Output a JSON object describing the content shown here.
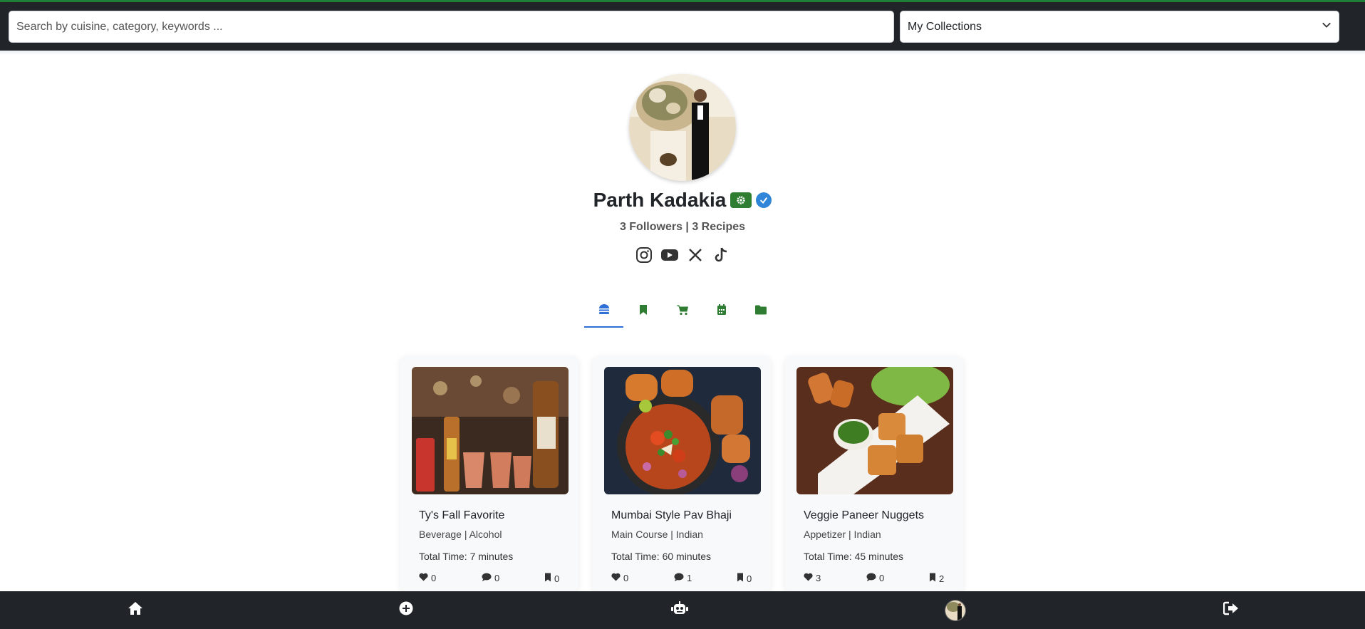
{
  "search": {
    "placeholder": "Search by cuisine, category, keywords ..."
  },
  "collections": {
    "selected": "My Collections"
  },
  "profile": {
    "name": "Parth Kadakia",
    "stats": "3 Followers | 3 Recipes",
    "socials": [
      "instagram-icon",
      "youtube-icon",
      "x-icon",
      "tiktok-icon"
    ]
  },
  "tabs": [
    {
      "icon": "burger-icon",
      "active": true
    },
    {
      "icon": "bookmark-icon",
      "active": false
    },
    {
      "icon": "cart-icon",
      "active": false
    },
    {
      "icon": "calendar-icon",
      "active": false
    },
    {
      "icon": "folder-icon",
      "active": false
    }
  ],
  "recipes": [
    {
      "title": "Ty's Fall Favorite",
      "category": "Beverage | Alcohol",
      "time": "Total Time: 7 minutes",
      "likes": "0",
      "comments": "0",
      "saves": "0"
    },
    {
      "title": "Mumbai Style Pav Bhaji",
      "category": "Main Course | Indian",
      "time": "Total Time: 60 minutes",
      "likes": "0",
      "comments": "1",
      "saves": "0"
    },
    {
      "title": "Veggie Paneer Nuggets",
      "category": "Appetizer | Indian",
      "time": "Total Time: 45 minutes",
      "likes": "3",
      "comments": "0",
      "saves": "2"
    }
  ],
  "bottom_nav": [
    "home-icon",
    "add-icon",
    "robot-icon",
    "profile-avatar",
    "logout-icon"
  ],
  "colors": {
    "topbar": "#212529",
    "accent_green": "#2e7d32",
    "active_tab": "#2f6fd8",
    "verified": "#2f86d8"
  }
}
